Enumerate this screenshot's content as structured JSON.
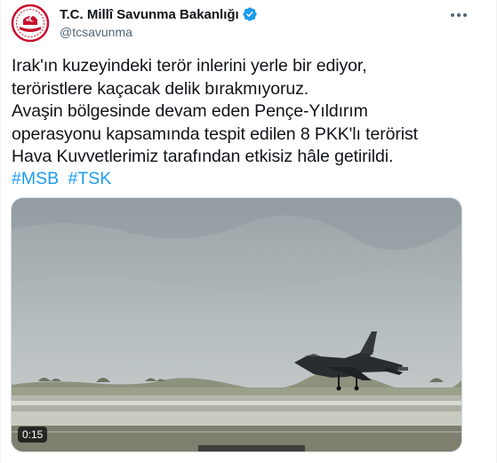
{
  "account": {
    "display_name": "T.C. Millî Savunma Bakanlığı",
    "handle": "@tcsavunma",
    "verified": true,
    "avatar_icon": "ministry-emblem-icon"
  },
  "tweet": {
    "text": "Irak'ın kuzeyindeki terör inlerini yerle bir ediyor,\nteröristlere kaçacak delik bırakmıyoruz.\nAvaşin bölgesinde devam eden Pençe-Yıldırım\noperasyonu kapsamında tespit edilen 8 PKK'lı terörist\nHava Kuvvetlerimiz tarafından etkisiz hâle getirildi.",
    "hashtags": [
      "#MSB",
      "#TSK"
    ]
  },
  "media": {
    "type": "video",
    "duration": "0:15",
    "icon": "fighter-jet-video-thumbnail"
  },
  "colors": {
    "link": "#1d9bf0",
    "verified": "#1d9bf0",
    "text": "#0f1419",
    "secondary": "#536471",
    "avatar_red": "#c8102e"
  }
}
